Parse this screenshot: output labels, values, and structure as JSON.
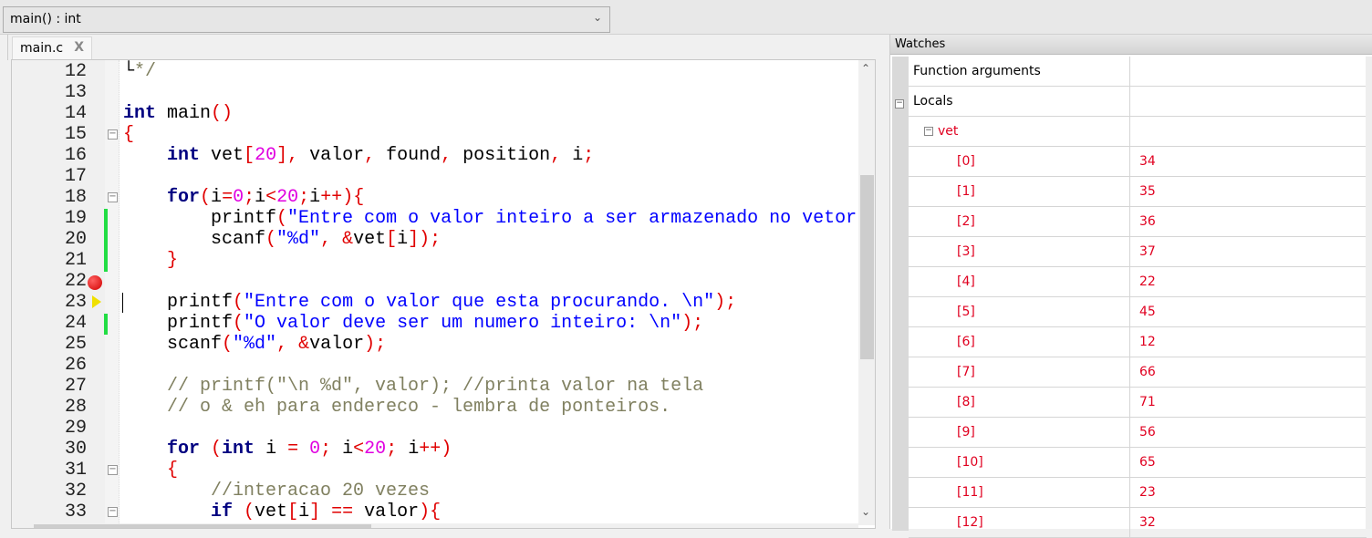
{
  "toolbar": {
    "scope_combo": "main() : int"
  },
  "tab": {
    "label": "main.c",
    "close": "X"
  },
  "editor": {
    "lines": [
      {
        "n": "12",
        "t": [
          [
            "└",
            "id"
          ],
          [
            "*/",
            "cm"
          ]
        ]
      },
      {
        "n": "13",
        "t": []
      },
      {
        "n": "14",
        "t": [
          [
            "int",
            "kw"
          ],
          [
            " main",
            "id"
          ],
          [
            "()",
            "op"
          ]
        ]
      },
      {
        "n": "15",
        "t": [
          [
            "{",
            "op"
          ]
        ]
      },
      {
        "n": "16",
        "t": [
          [
            "    ",
            "id"
          ],
          [
            "int",
            "kw"
          ],
          [
            " vet",
            "id"
          ],
          [
            "[",
            "op"
          ],
          [
            "20",
            "num"
          ],
          [
            "],",
            "op"
          ],
          [
            " valor",
            "id"
          ],
          [
            ",",
            "op"
          ],
          [
            " found",
            "id"
          ],
          [
            ",",
            "op"
          ],
          [
            " position",
            "id"
          ],
          [
            ",",
            "op"
          ],
          [
            " i",
            "id"
          ],
          [
            ";",
            "op"
          ]
        ]
      },
      {
        "n": "17",
        "t": []
      },
      {
        "n": "18",
        "t": [
          [
            "    ",
            "id"
          ],
          [
            "for",
            "kw"
          ],
          [
            "(",
            "op"
          ],
          [
            "i",
            "id"
          ],
          [
            "=",
            "op"
          ],
          [
            "0",
            "num"
          ],
          [
            ";",
            "op"
          ],
          [
            "i",
            "id"
          ],
          [
            "<",
            "op"
          ],
          [
            "20",
            "num"
          ],
          [
            ";",
            "op"
          ],
          [
            "i",
            "id"
          ],
          [
            "++){",
            "op"
          ]
        ]
      },
      {
        "n": "19",
        "t": [
          [
            "        printf",
            "id"
          ],
          [
            "(",
            "op"
          ],
          [
            "\"Entre com o valor inteiro a ser armazenado no vetor",
            "str"
          ]
        ]
      },
      {
        "n": "20",
        "t": [
          [
            "        scanf",
            "id"
          ],
          [
            "(",
            "op"
          ],
          [
            "\"%d\"",
            "str"
          ],
          [
            ", &",
            "op"
          ],
          [
            "vet",
            "id"
          ],
          [
            "[",
            "op"
          ],
          [
            "i",
            "id"
          ],
          [
            "]);",
            "op"
          ]
        ]
      },
      {
        "n": "21",
        "t": [
          [
            "    ",
            "id"
          ],
          [
            "}",
            "op"
          ]
        ]
      },
      {
        "n": "22",
        "t": []
      },
      {
        "n": "23",
        "t": [
          [
            "    printf",
            "id"
          ],
          [
            "(",
            "op"
          ],
          [
            "\"Entre com o valor que esta procurando. \\n\"",
            "str"
          ],
          [
            ");",
            "op"
          ]
        ]
      },
      {
        "n": "24",
        "t": [
          [
            "    printf",
            "id"
          ],
          [
            "(",
            "op"
          ],
          [
            "\"O valor deve ser um numero inteiro: \\n\"",
            "str"
          ],
          [
            ");",
            "op"
          ]
        ]
      },
      {
        "n": "25",
        "t": [
          [
            "    scanf",
            "id"
          ],
          [
            "(",
            "op"
          ],
          [
            "\"%d\"",
            "str"
          ],
          [
            ", &",
            "op"
          ],
          [
            "valor",
            "id"
          ],
          [
            ");",
            "op"
          ]
        ]
      },
      {
        "n": "26",
        "t": []
      },
      {
        "n": "27",
        "t": [
          [
            "    // printf(\"\\n %d\", valor); //printa valor na tela",
            "cm"
          ]
        ]
      },
      {
        "n": "28",
        "t": [
          [
            "    // o & eh para endereco - lembra de ponteiros.",
            "cm"
          ]
        ]
      },
      {
        "n": "29",
        "t": []
      },
      {
        "n": "30",
        "t": [
          [
            "    ",
            "id"
          ],
          [
            "for",
            "kw"
          ],
          [
            " (",
            "op"
          ],
          [
            "int",
            "kw"
          ],
          [
            " i ",
            "id"
          ],
          [
            "=",
            "op"
          ],
          [
            " ",
            "id"
          ],
          [
            "0",
            "num"
          ],
          [
            ";",
            "op"
          ],
          [
            " i",
            "id"
          ],
          [
            "<",
            "op"
          ],
          [
            "20",
            "num"
          ],
          [
            ";",
            "op"
          ],
          [
            " i",
            "id"
          ],
          [
            "++)",
            "op"
          ]
        ]
      },
      {
        "n": "31",
        "t": [
          [
            "    ",
            "id"
          ],
          [
            "{",
            "op"
          ]
        ]
      },
      {
        "n": "32",
        "t": [
          [
            "        //interacao 20 vezes",
            "cm"
          ]
        ]
      },
      {
        "n": "33",
        "t": [
          [
            "        ",
            "id"
          ],
          [
            "if",
            "kw"
          ],
          [
            " (",
            "op"
          ],
          [
            "vet",
            "id"
          ],
          [
            "[",
            "op"
          ],
          [
            "i",
            "id"
          ],
          [
            "]",
            "op"
          ],
          [
            " == ",
            "op"
          ],
          [
            "valor",
            "id"
          ],
          [
            "){",
            "op"
          ]
        ]
      }
    ]
  },
  "watches": {
    "title": "Watches",
    "function_arguments": "Function arguments",
    "locals": "Locals",
    "var": "vet",
    "items": [
      [
        "[0]",
        "34"
      ],
      [
        "[1]",
        "35"
      ],
      [
        "[2]",
        "36"
      ],
      [
        "[3]",
        "37"
      ],
      [
        "[4]",
        "22"
      ],
      [
        "[5]",
        "45"
      ],
      [
        "[6]",
        "12"
      ],
      [
        "[7]",
        "66"
      ],
      [
        "[8]",
        "71"
      ],
      [
        "[9]",
        "56"
      ],
      [
        "[10]",
        "65"
      ],
      [
        "[11]",
        "23"
      ],
      [
        "[12]",
        "32"
      ]
    ]
  }
}
